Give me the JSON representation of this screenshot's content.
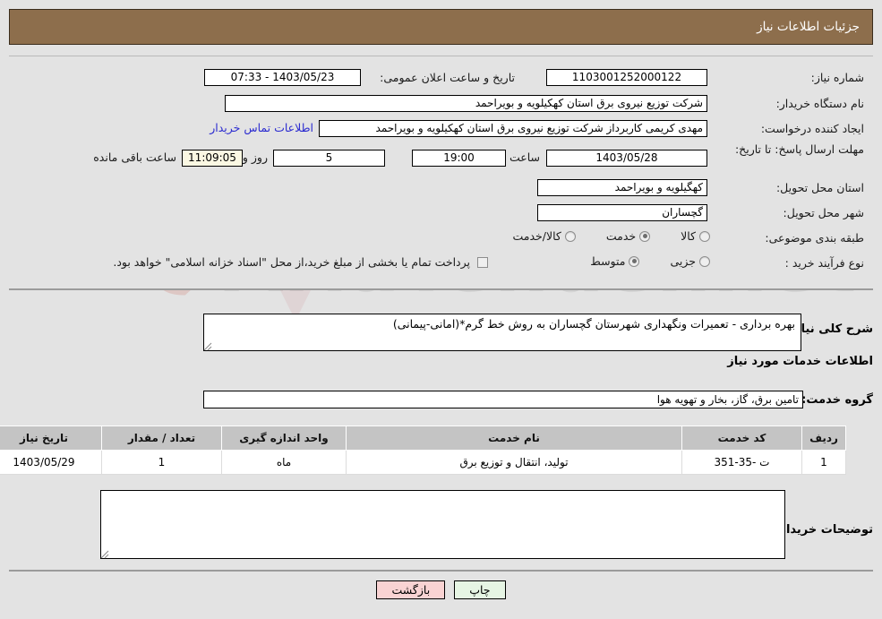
{
  "header": {
    "title": "جزئیات اطلاعات نیاز"
  },
  "colors": {
    "header_bg": "#8d6e4c",
    "page_bg": "#e3e3e3",
    "link": "#2b2bd0",
    "table_header_bg": "#c4c4c4",
    "print_btn_bg": "#e6f5e4",
    "back_btn_bg": "#f9d3d3",
    "highlight_field_bg": "#fbf8e3"
  },
  "info": {
    "need_number_label": "شماره نیاز:",
    "need_number_value": "1103001252000122",
    "announce_label": "تاریخ و ساعت اعلان عمومی:",
    "announce_value": "1403/05/23 - 07:33",
    "buyer_org_label": "نام دستگاه خریدار:",
    "buyer_org_value": "شرکت توزیع نیروی برق استان کهکیلویه و بویراحمد",
    "creator_label": "ایجاد کننده درخواست:",
    "creator_value": "مهدی کریمی کاربرداز شرکت توزیع نیروی برق استان کهکیلویه و بویراحمد",
    "contact_link": "اطلاعات تماس خریدار",
    "deadline_label": "مهلت ارسال پاسخ: تا تاریخ:",
    "deadline_date": "1403/05/28",
    "hour_label": "ساعت",
    "deadline_hour": "19:00",
    "days_value": "5",
    "days_label": "روز و",
    "remaining_time": "11:09:05",
    "remaining_label": "ساعت باقی مانده",
    "province_label": "استان محل تحویل:",
    "province_value": "کهگیلویه و بویراحمد",
    "city_label": "شهر محل تحویل:",
    "city_value": "گچساران",
    "category_label": "طبقه بندی موضوعی:",
    "category_options": [
      {
        "label": "کالا",
        "selected": false
      },
      {
        "label": "خدمت",
        "selected": true
      },
      {
        "label": "کالا/خدمت",
        "selected": false
      }
    ],
    "process_label": "نوع فرآیند خرید :",
    "process_options": [
      {
        "label": "جزیی",
        "selected": false
      },
      {
        "label": "متوسط",
        "selected": true
      }
    ],
    "treasury_checkbox_checked": false,
    "treasury_note": "پرداخت تمام یا بخشی از مبلغ خرید،از محل \"اسناد خزانه اسلامی\" خواهد بود."
  },
  "description": {
    "label": "شرح کلی نیاز:",
    "value": "بهره برداری - تعمیرات ونگهداری شهرستان گچساران به روش خط گرم*(امانی-پیمانی)"
  },
  "services": {
    "section_title": "اطلاعات خدمات مورد نیاز",
    "group_label": "گروه خدمت:",
    "group_value": "تامین برق، گاز، بخار و تهویه هوا",
    "table": {
      "columns": [
        "ردیف",
        "کد خدمت",
        "نام خدمت",
        "واحد اندازه گیری",
        "تعداد / مقدار",
        "تاریخ نیاز"
      ],
      "rows": [
        {
          "row_no": "1",
          "service_code": "ت -35-351",
          "service_name": "تولید، انتقال و توزیع برق",
          "unit": "ماه",
          "quantity": "1",
          "need_date": "1403/05/29"
        }
      ]
    }
  },
  "buyer_notes": {
    "label": "توضیحات خریدار:",
    "value": ""
  },
  "footer": {
    "print_label": "چاپ",
    "back_label": "بازگشت"
  }
}
